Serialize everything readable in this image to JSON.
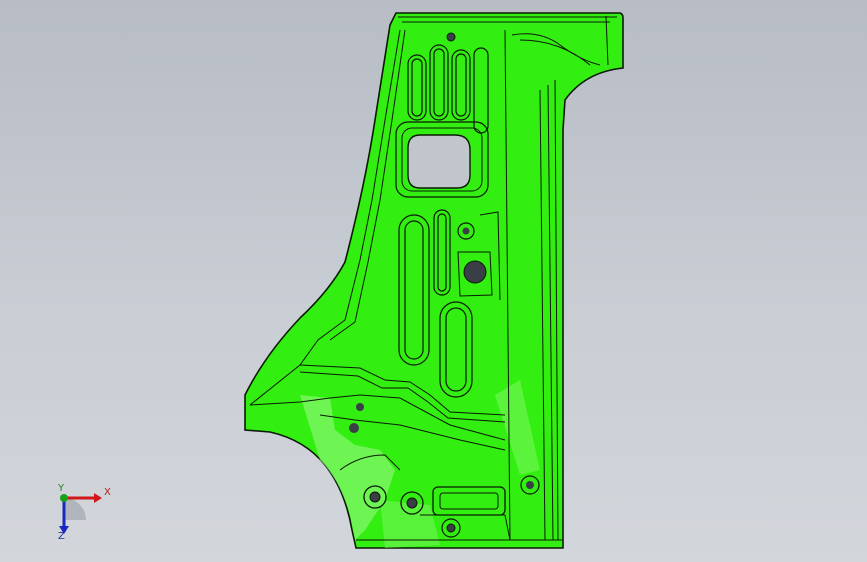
{
  "viewport": {
    "background_top": "#b7bcc5",
    "background_bottom": "#d3d6db"
  },
  "model": {
    "part_color": "#33ee11",
    "edge_color": "#0a1a05",
    "hole_color": "#3a3f46"
  },
  "triad": {
    "x_label": "X",
    "y_label": "Y",
    "z_label": "Z",
    "x_color": "#d01818",
    "y_color": "#18a018",
    "z_color": "#1828c0"
  }
}
